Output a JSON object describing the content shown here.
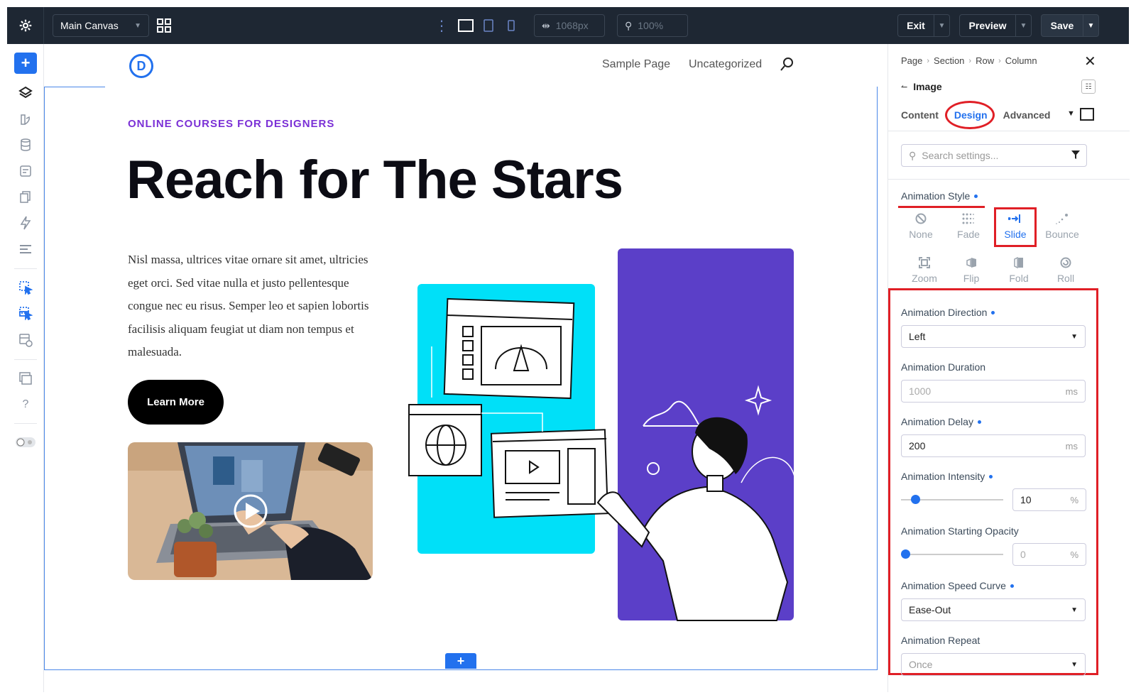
{
  "topbar": {
    "canvas_label": "Main Canvas",
    "width_value": "1068px",
    "zoom_value": "100%",
    "exit_label": "Exit",
    "preview_label": "Preview",
    "save_label": "Save"
  },
  "site": {
    "logo_letter": "D",
    "nav": [
      "Sample Page",
      "Uncategorized"
    ],
    "eyebrow": "ONLINE COURSES FOR DESIGNERS",
    "title": "Reach for The Stars",
    "body": "Nisl massa, ultrices vitae ornare sit amet, ultricies eget orci. Sed vitae nulla et justo pellentesque congue nec eu risus. Semper leo et sapien lobortis facilisis aliquam feugiat ut diam non tempus et malesuada.",
    "button_label": "Learn More"
  },
  "panel": {
    "breadcrumbs": [
      "Page",
      "Section",
      "Row",
      "Column"
    ],
    "module_title": "Image",
    "tabs": [
      "Content",
      "Design",
      "Advanced"
    ],
    "search_placeholder": "Search settings...",
    "animation_style_label": "Animation Style",
    "styles": [
      "None",
      "Fade",
      "Slide",
      "Bounce",
      "Zoom",
      "Flip",
      "Fold",
      "Roll"
    ],
    "selected_style": "Slide",
    "direction_label": "Animation Direction",
    "direction_value": "Left",
    "duration_label": "Animation Duration",
    "duration_value": "1000",
    "duration_unit": "ms",
    "delay_label": "Animation Delay",
    "delay_value": "200",
    "delay_unit": "ms",
    "intensity_label": "Animation Intensity",
    "intensity_value": "10",
    "intensity_unit": "%",
    "opacity_label": "Animation Starting Opacity",
    "opacity_value": "0",
    "opacity_unit": "%",
    "speed_label": "Animation Speed Curve",
    "speed_value": "Ease-Out",
    "repeat_label": "Animation Repeat",
    "repeat_value": "Once"
  },
  "colors": {
    "accent": "#2271ee",
    "topbar": "#1e2733",
    "eyebrow": "#7b30d6",
    "highlight": "#e01f26",
    "illus_cyan": "#00e0f8",
    "illus_purple": "#5b3fc8"
  }
}
